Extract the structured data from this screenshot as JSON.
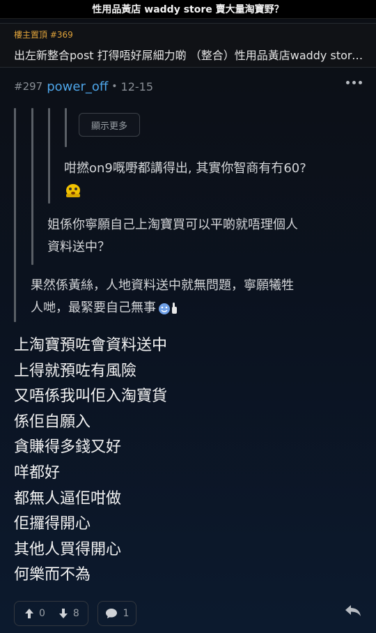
{
  "header": {
    "title": "性用品黃店 waddy store 賣大量淘寶野？"
  },
  "pinned": {
    "label": "樓主置頂 #369",
    "title": "出左新整合post 打得唔好屌細力啲 （整合）性用品黃店waddy store 賣大量淘寶野？"
  },
  "post": {
    "number": "#297",
    "username": "power_off",
    "separator": "•",
    "date": "12-15",
    "show_more_label": "顯示更多",
    "quote_level3": {
      "line1": "咁撚on9嘅嘢都講得出, 其實你智商有冇60?"
    },
    "quote_level2": {
      "line1": "姐係你寧願自己上淘寶買可以平啲就唔理個人",
      "line2": "資料送中？"
    },
    "quote_level1": {
      "line1": "果然係黃絲，人地資料送中就無問題，寧願犧牲",
      "line2": "人哋，最緊要自己無事"
    },
    "body_lines": [
      "上淘寶預咗會資料送中",
      "上得就預咗有風險",
      "又唔係我叫佢入淘寶貨",
      "係佢自願入",
      "貪賺得多錢又好",
      "咩都好",
      "都無人逼佢咁做",
      "佢攞得開心",
      "其他人買得開心",
      "何樂而不為"
    ]
  },
  "actions": {
    "upvotes": "0",
    "downvotes": "8",
    "comments": "1"
  },
  "icons": {
    "more": "more-dots-icon",
    "up": "arrow-up-icon",
    "down": "arrow-down-icon",
    "comment": "comment-icon",
    "reply": "reply-icon",
    "emoji_shock": "shocked-emoji-icon",
    "emoji_thumb": "smile-thumbs-up-emoji-icon"
  },
  "colors": {
    "username": "#4ea6ea",
    "pinned_label": "#e0a33a",
    "emoji": "#f2c200"
  }
}
